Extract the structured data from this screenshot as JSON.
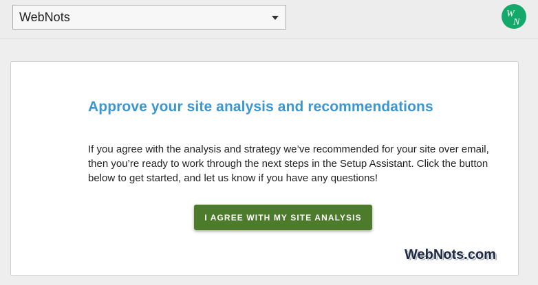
{
  "header": {
    "site_selector": {
      "value": "WebNots"
    },
    "logo": {
      "icon": "webnots-logo-icon",
      "color": "#15a86b"
    }
  },
  "card": {
    "title": "Approve your site analysis and recommendations",
    "body": "If you agree with the analysis and strategy we’ve recommended for your site over email, then you’re ready to work through the next steps in the Setup Assistant. Click the button below to get started, and let us know if you have any questions!",
    "button_label": "I AGREE WITH MY SITE ANALYSIS"
  },
  "watermark": "WebNots.com",
  "colors": {
    "title": "#3c96cf",
    "button": "#4c7b2b"
  }
}
